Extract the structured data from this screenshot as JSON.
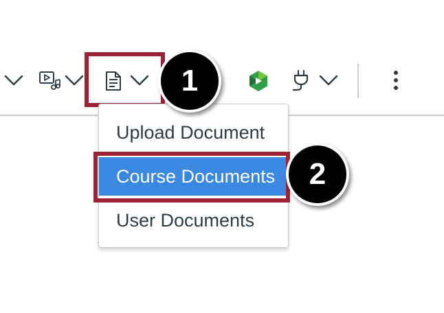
{
  "toolbar": {
    "icons": [
      "chevron-down-icon",
      "media-icon",
      "document-icon",
      "studio-logo-icon",
      "plug-icon",
      "more-options-icon"
    ]
  },
  "callouts": {
    "step1": "1",
    "step2": "2"
  },
  "document_menu": {
    "items": [
      {
        "label": "Upload Document",
        "selected": false
      },
      {
        "label": "Course Documents",
        "selected": true
      },
      {
        "label": "User Documents",
        "selected": false
      }
    ]
  },
  "colors": {
    "highlight_border": "#9b2335",
    "selected_item_bg": "#3b88e0",
    "menu_text": "#2d3b45",
    "icon_color": "#2d3b45",
    "divider": "#c7cdd1",
    "studio_green": "#2e9e49"
  }
}
